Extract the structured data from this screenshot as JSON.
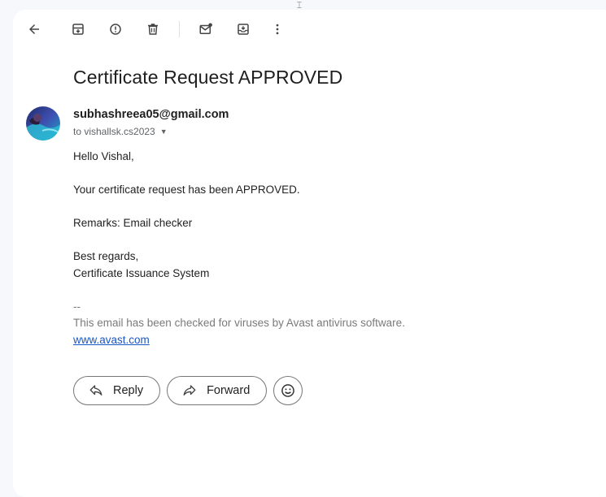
{
  "toolbar": {
    "icons": [
      "back-arrow-icon",
      "archive-icon",
      "report-spam-icon",
      "delete-icon",
      "mark-unread-icon",
      "move-to-icon",
      "more-options-icon"
    ]
  },
  "email": {
    "subject": "Certificate Request APPROVED",
    "sender": "subhashreea05@gmail.com",
    "recipient": "to vishallsk.cs2023",
    "greeting": "Hello Vishal,",
    "line1": "Your certificate request has been APPROVED.",
    "remarks": "Remarks: Email checker",
    "closing": "Best regards,",
    "signoff": "Certificate Issuance System",
    "sig_dashes": "--",
    "sig_text": "This email has been checked for viruses by Avast antivirus software.",
    "sig_link": "www.avast.com"
  },
  "actions": {
    "reply_label": "Reply",
    "forward_label": "Forward"
  },
  "colors": {
    "background": "#f6f8fc",
    "link": "#1a56c4",
    "text": "#1f1f1f",
    "muted": "#5f6368"
  }
}
